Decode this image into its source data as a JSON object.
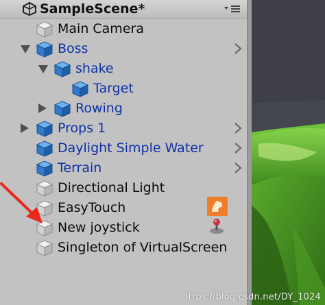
{
  "header": {
    "scene_name": "SampleScene*",
    "menu_icon": "options-menu-icon"
  },
  "hierarchy": {
    "items": [
      {
        "label": "Main Camera",
        "prefab": false,
        "fold": "none",
        "chevron": false
      },
      {
        "label": "Boss",
        "prefab": true,
        "fold": "open",
        "chevron": true
      },
      {
        "label": "shake",
        "prefab": true,
        "fold": "open",
        "chevron": false
      },
      {
        "label": "Target",
        "prefab": true,
        "fold": "none",
        "chevron": false
      },
      {
        "label": "Rowing",
        "prefab": true,
        "fold": "closed",
        "chevron": false
      },
      {
        "label": "Props 1",
        "prefab": true,
        "fold": "closed",
        "chevron": true
      },
      {
        "label": "Daylight Simple Water",
        "prefab": true,
        "fold": "none",
        "chevron": true
      },
      {
        "label": "Terrain",
        "prefab": true,
        "fold": "none",
        "chevron": true
      },
      {
        "label": "Directional Light",
        "prefab": false,
        "fold": "none",
        "chevron": false
      },
      {
        "label": "EasyTouch",
        "prefab": false,
        "fold": "none",
        "chevron": false
      },
      {
        "label": "New joystick",
        "prefab": false,
        "fold": "none",
        "chevron": false
      },
      {
        "label": "Singleton of VirtualScreen",
        "prefab": false,
        "fold": "none",
        "chevron": false
      }
    ]
  },
  "watermark": "https://blog.csdn.net/DY_1024",
  "colors": {
    "prefab_text": "#0f30a6",
    "normal_text": "#0b0b0b",
    "panel_bg": "#c2c2c2",
    "prefab_cube": "#3b86d4",
    "gray_cube": "#e2e2e2",
    "annotation_arrow": "#e8291c",
    "terrain_green": "#6fc23a"
  }
}
